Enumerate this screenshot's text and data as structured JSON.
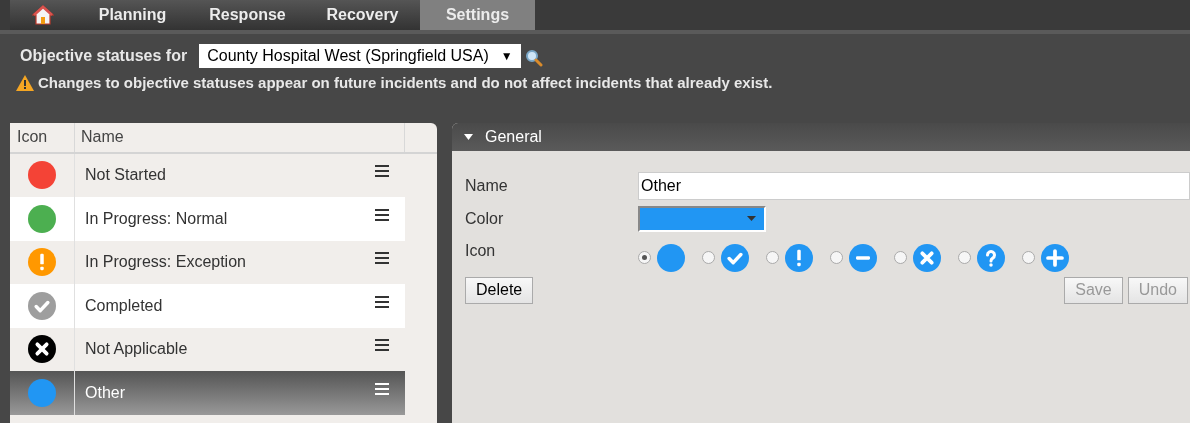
{
  "tabs": [
    {
      "kind": "home",
      "selected": false
    },
    {
      "label": "Planning",
      "selected": false
    },
    {
      "label": "Response",
      "selected": false
    },
    {
      "label": "Recovery",
      "selected": false
    },
    {
      "label": "Settings",
      "selected": true
    }
  ],
  "filter": {
    "label": "Objective statuses for",
    "value": "County Hospital West (Springfield USA)",
    "arrow": "▼"
  },
  "warning": "Changes to objective statuses appear on future incidents and do not affect incidents that already exist.",
  "table": {
    "columns": [
      "Icon",
      "Name"
    ],
    "rows": [
      {
        "name": "Not Started",
        "kind": "circle",
        "color": "#f44336",
        "selected": false
      },
      {
        "name": "In Progress: Normal",
        "kind": "circle",
        "color": "#4caf50",
        "selected": false
      },
      {
        "name": "In Progress: Exception",
        "kind": "exclamation",
        "color": "#ff9800",
        "selected": false
      },
      {
        "name": "Completed",
        "kind": "check",
        "color": "#9e9e9e",
        "selected": false
      },
      {
        "name": "Not Applicable",
        "kind": "x",
        "color": "#000000",
        "selected": false
      },
      {
        "name": "Other",
        "kind": "circle",
        "color": "#2196f3",
        "selected": true
      }
    ]
  },
  "panel": {
    "title": "General",
    "expanded": true,
    "name_label": "Name",
    "name_value": "Other",
    "color_label": "Color",
    "color": "#2196f3",
    "icon_label": "Icon",
    "icon_options": [
      {
        "kind": "circle",
        "selected": true
      },
      {
        "kind": "check",
        "selected": false
      },
      {
        "kind": "exclamation",
        "selected": false
      },
      {
        "kind": "minus",
        "selected": false
      },
      {
        "kind": "x",
        "selected": false
      },
      {
        "kind": "question",
        "selected": false
      },
      {
        "kind": "plus",
        "selected": false
      }
    ],
    "buttons": [
      {
        "label": "Delete",
        "disabled": false
      },
      {
        "label": "Save",
        "disabled": true
      },
      {
        "label": "Undo",
        "disabled": true
      }
    ]
  }
}
